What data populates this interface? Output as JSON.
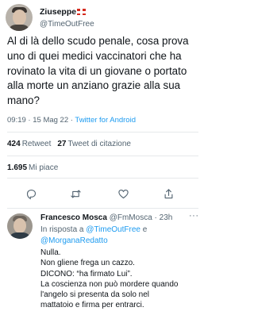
{
  "tweet": {
    "author_name": "Ziuseppe",
    "author_handle": "@TimeOutFree",
    "text": "Al di là dello scudo penale, cosa prova uno di quei medici vaccinatori che ha rovinato la vita di un giovane o portato alla morte un anziano grazie alla sua mano?",
    "time": "09:19",
    "date": "15 Mag 22",
    "separator": " · ",
    "client": "Twitter for Android",
    "retweet_count": "424",
    "retweet_label": "Retweet",
    "quote_count": "27",
    "quote_label": "Tweet di citazione",
    "like_count": "1.695",
    "like_label": "Mi piace"
  },
  "actions": [
    {
      "icon": "reply-icon"
    },
    {
      "icon": "retweet-icon"
    },
    {
      "icon": "like-icon"
    },
    {
      "icon": "share-icon"
    }
  ],
  "reply": {
    "author_name": "Francesco Mosca",
    "author_handle": "@FmMosca",
    "time": "23h",
    "separator": " · ",
    "more": "···",
    "in_reply_prefix": "In risposta a ",
    "mention_1": "@TimeOutFree",
    "mention_join": " e",
    "mention_2": "@MorganaRedatto",
    "lines": [
      "Nulla.",
      "Non gliene frega un cazzo.",
      "DICONO: “ha firmato Lui”.",
      "La coscienza non può mordere quando",
      "l'angelo si presenta da solo nel",
      "mattatoio e firma per entrarci."
    ]
  },
  "colors": {
    "accent": "#1d9bf0",
    "secondary_text": "#536471",
    "divider": "#e6e9eb"
  }
}
